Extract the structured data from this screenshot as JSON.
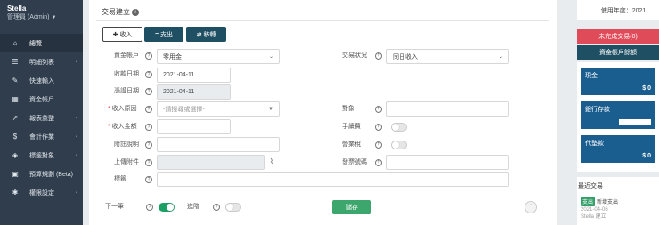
{
  "user": {
    "name": "Stella",
    "role": "管理員 (Admin)"
  },
  "nav": [
    {
      "label": "總覽",
      "icon": "home-icon",
      "glyph": "⌂"
    },
    {
      "label": "明細列表",
      "icon": "list-icon",
      "glyph": "☰"
    },
    {
      "label": "快速輸入",
      "icon": "pencil-icon",
      "glyph": "✎"
    },
    {
      "label": "資金帳戶",
      "icon": "bank-icon",
      "glyph": "▦"
    },
    {
      "label": "報表彙整",
      "icon": "chart-icon",
      "glyph": "↗"
    },
    {
      "label": "會計作業",
      "icon": "dollar-icon",
      "glyph": "$"
    },
    {
      "label": "標籤對象",
      "icon": "tag-icon",
      "glyph": "◈"
    },
    {
      "label": "預算規劃 (Beta)",
      "icon": "calculator-icon",
      "glyph": "▣"
    },
    {
      "label": "權限設定",
      "icon": "gear-icon",
      "glyph": "✱"
    }
  ],
  "card": {
    "title": "交易建立"
  },
  "tabs": {
    "income": "收入",
    "expense": "支出",
    "transfer": "移轉"
  },
  "form": {
    "account_label": "資金帳戶",
    "account_value": "零用金",
    "status_label": "交易狀況",
    "status_value": "同日收入",
    "receive_date_label": "收款日期",
    "receive_date_value": "2021-04-11",
    "entry_date_label": "憑證日期",
    "entry_date_value": "2021-04-11",
    "reason_label": "收入原因",
    "reason_placeholder": "-請搜尋或選擇-",
    "target_label": "對象",
    "amount_label": "收入金額",
    "fee_label": "手續費",
    "note_label": "附註說明",
    "tax_label": "營業稅",
    "attach_label": "上傳附件",
    "invoice_label": "發票號碼",
    "tag_label": "標籤",
    "next_label": "下一筆",
    "advanced_label": "進階",
    "save_label": "儲存"
  },
  "right": {
    "year": "使用年度：2021",
    "pending_btn": "未完成交易(0)",
    "balance_btn": "資金帳戶餘額",
    "accounts": [
      {
        "name": "現金",
        "value": "$ 0"
      },
      {
        "name": "銀行存款",
        "value": ""
      },
      {
        "name": "代墊款",
        "value": "$ 0"
      }
    ],
    "recent_title": "最近交易",
    "recent": {
      "badge": "支出",
      "desc": "新增支出",
      "date": "2021-04-06",
      "by": "Stella 建立"
    }
  },
  "colors": {
    "sidebar": "#2f3d4c",
    "primary": "#1f4f63",
    "success": "#3ca66c",
    "danger": "#e04b5a",
    "account": "#1a5d8f"
  }
}
